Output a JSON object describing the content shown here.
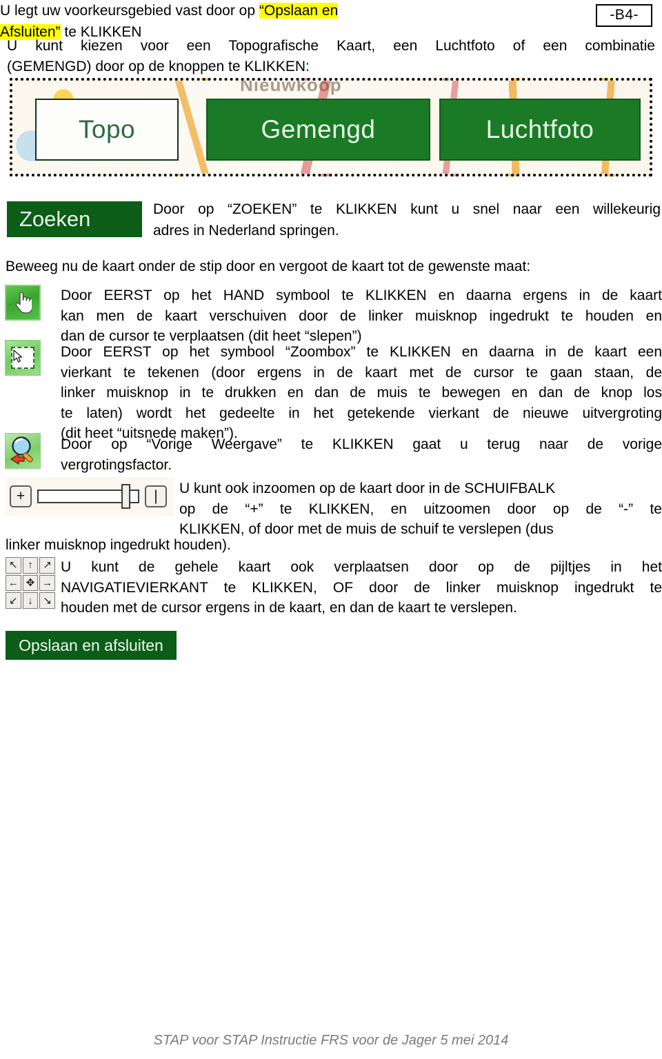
{
  "page": {
    "marker": "-B4-",
    "footer": "STAP voor STAP Instructie FRS voor de Jager 5 mei 2014"
  },
  "intro": {
    "line1": "U kunt kiezen voor een Topografische Kaart, een Luchtfoto of een combinatie",
    "line2": "(GEMENGD) door op de knoppen te KLIKKEN:"
  },
  "map_banner": {
    "partial_label": "Nieuwkoop",
    "buttons": [
      {
        "label": "Topo",
        "state": "inactive",
        "bg": "#fdfdfb",
        "fg": "#2c6b43"
      },
      {
        "label": "Gemengd",
        "state": "active",
        "bg": "#1a7a26",
        "fg": "#eaf7e8"
      },
      {
        "label": "Luchtfoto",
        "state": "active",
        "bg": "#1a7a26",
        "fg": "#eaf7e8"
      }
    ]
  },
  "zoeken": {
    "button_label": "Zoeken",
    "line1": "Door op “ZOEKEN” te KLIKKEN kunt u snel naar een willekeurig",
    "line2": "adres in Nederland springen."
  },
  "beweeg_heading": "Beweeg nu de kaart onder de stip door en vergoot de kaart tot de gewenste maat:",
  "hand_block": {
    "icon": "hand-cursor-icon",
    "line1": "Door EERST op het HAND symbool te KLIKKEN en daarna ergens in de kaart",
    "line2": "kan men de kaart verschuiven door de linker muisknop ingedrukt te houden en",
    "line3": "dan de cursor te verplaatsen (dit heet “slepen”)"
  },
  "zoombox_block": {
    "icon": "zoombox-icon",
    "line1": "Door EERST op het symbool “Zoombox” te KLIKKEN en daarna in de kaart een",
    "line2": "vierkant te tekenen (door ergens in de kaart met de cursor te gaan staan, de",
    "line3": "linker muisknop in te drukken en dan de muis te bewegen en dan de knop los",
    "line4": "te laten) wordt het gedeelte in het getekende vierkant de nieuwe uitvergroting",
    "line5": "(dit heet “uitsnede maken”)."
  },
  "prev_view_block": {
    "icon": "previous-view-magnifier-icon",
    "line1": "Door op “Vorige Weergave” te KLIKKEN gaat u terug naar de vorige",
    "line2": "vergrotingsfactor."
  },
  "slider_block": {
    "plus_label": "+",
    "minus_label": "|",
    "line1": "U kunt ook inzoomen op de kaart door in de SCHUIFBALK",
    "line2": "op de “+” te KLIKKEN, en uitzoomen door op de “-” te",
    "line3": "KLIKKEN, of door met de muis de schuif te verslepen (dus",
    "line4": "linker muisknop ingedrukt houden)."
  },
  "nav_block": {
    "icon": "navigation-square-icon",
    "arrows": [
      "↖",
      "↑",
      "↗",
      "←",
      "✥",
      "→",
      "↙",
      "↓",
      "↘"
    ],
    "line1": "U kunt de gehele kaart ook verplaatsen door op de pijltjes in het",
    "line2": "NAVIGATIEVIERKANT te KLIKKEN, OF door de linker muisknop ingedrukt te",
    "line3": "houden met de cursor ergens in de kaart, en dan de kaart te verslepen."
  },
  "save_block": {
    "button_label": "Opslaan en afsluiten",
    "text_before": "U legt uw voorkeursgebied vast door op ",
    "highlight_1": "“Opslaan en",
    "highlight_2": "Afsluiten”",
    "text_after": " te KLIKKEN"
  }
}
